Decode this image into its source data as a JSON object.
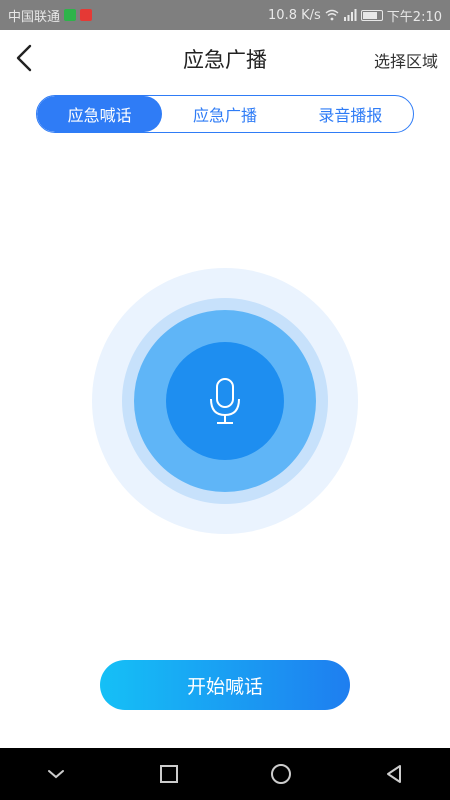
{
  "status_bar": {
    "carrier": "中国联通",
    "speed": "10.8 K/s",
    "time": "下午2:10",
    "icons": [
      "app-badge-icon",
      "notification-badge-icon",
      "wifi-icon",
      "signal-icon",
      "battery-icon"
    ]
  },
  "header": {
    "title": "应急广播",
    "right_action": "选择区域",
    "back_icon": "chevron-left-icon"
  },
  "tabs": [
    {
      "label": "应急喊话",
      "active": true
    },
    {
      "label": "应急广播",
      "active": false
    },
    {
      "label": "录音播报",
      "active": false
    }
  ],
  "mic": {
    "icon": "microphone-icon"
  },
  "action_button": {
    "label": "开始喊话"
  },
  "nav_bar": {
    "icons": [
      "chevron-down-icon",
      "square-icon",
      "circle-icon",
      "triangle-back-icon"
    ]
  },
  "colors": {
    "accent": "#2f7cf6",
    "ring_outer": "#eaf3fe",
    "ring_middle": "#c7e1fb",
    "ring_inner": "#5fb5f7",
    "mic_core": "#1e8ef0",
    "button_start": "#15c0f6",
    "button_end": "#1e7ef0"
  }
}
